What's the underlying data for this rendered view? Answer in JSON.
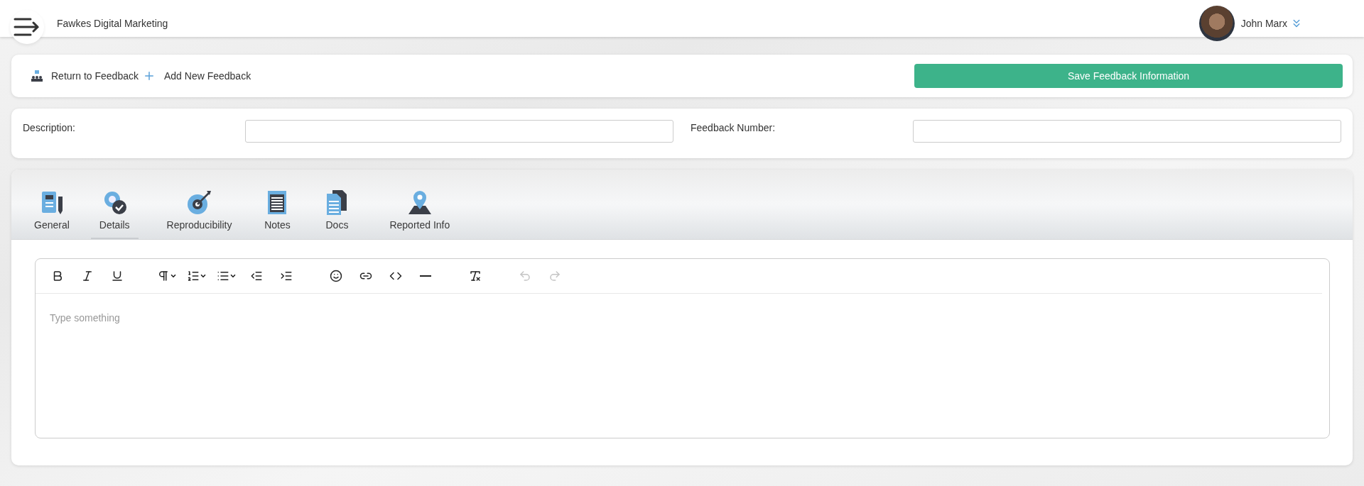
{
  "header": {
    "company": "Fawkes Digital Marketing",
    "user": {
      "name": "John Marx"
    }
  },
  "actions": {
    "links": [
      {
        "kind": "return",
        "label": "Return to Feedback"
      },
      {
        "kind": "add",
        "label": "Add New Feedback"
      }
    ],
    "save_button": "Save Feedback Information"
  },
  "form": {
    "fields": [
      {
        "label": "Description:"
      },
      {
        "label": "Feedback Number:"
      }
    ]
  },
  "tabs": [
    {
      "kind": "general",
      "label": "General",
      "selected": false
    },
    {
      "kind": "details",
      "label": "Details",
      "selected": true
    },
    {
      "kind": "reproducibility",
      "label": "Reproducibility",
      "selected": false
    },
    {
      "kind": "notes",
      "label": "Notes",
      "selected": false
    },
    {
      "kind": "docs",
      "label": "Docs",
      "selected": false
    },
    {
      "kind": "reported",
      "label": "Reported Info",
      "selected": false
    }
  ],
  "editor": {
    "toolbar": [
      {
        "kind": "bold",
        "disabled": false
      },
      {
        "kind": "italic",
        "disabled": false
      },
      {
        "kind": "underline",
        "disabled": false
      },
      {
        "kind": "gap"
      },
      {
        "kind": "paragraph",
        "disabled": false
      },
      {
        "kind": "ordered",
        "disabled": false
      },
      {
        "kind": "bullet",
        "disabled": false
      },
      {
        "kind": "outdent",
        "disabled": false
      },
      {
        "kind": "indent",
        "disabled": false
      },
      {
        "kind": "gap"
      },
      {
        "kind": "emoji",
        "disabled": false
      },
      {
        "kind": "link",
        "disabled": false
      },
      {
        "kind": "code",
        "disabled": false
      },
      {
        "kind": "rule",
        "disabled": false
      },
      {
        "kind": "gap"
      },
      {
        "kind": "clear",
        "disabled": false
      },
      {
        "kind": "gap"
      },
      {
        "kind": "undo",
        "disabled": true
      },
      {
        "kind": "redo",
        "disabled": true
      }
    ],
    "placeholder": "Type something"
  }
}
